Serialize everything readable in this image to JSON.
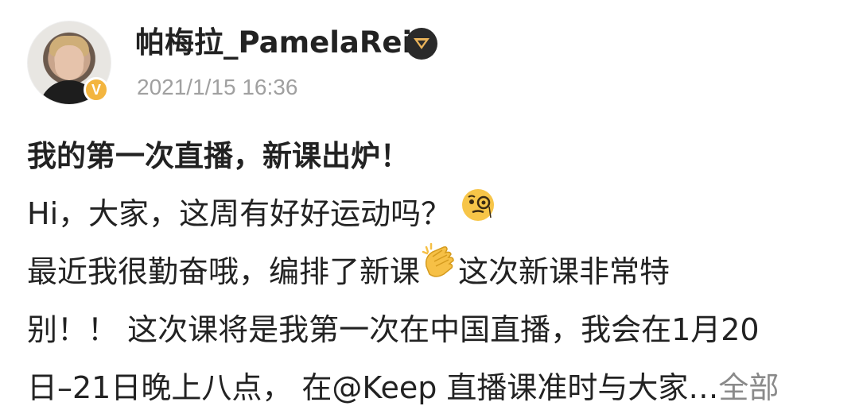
{
  "post": {
    "username": "帕梅拉_PamelaReif",
    "timestamp": "2021/1/15 16:36",
    "title": "我的第一次直播，新课出炉！",
    "line1_text": "Hi，大家，这周有好好运动吗？",
    "line1_emoji": "thinking-monocle-icon",
    "line2_part1": "最近我很勤奋哦，编排了新课",
    "line2_emoji": "clapping-hands-icon",
    "line2_part2": "这次新课非常特",
    "line3": "别！！ 这次课将是我第一次在中国直播，我会在1月20",
    "line4": "日–21日晚上八点， 在@Keep 直播课准时与大家…",
    "more_label": "全部"
  },
  "colors": {
    "verify_badge": "#f3b53f",
    "timestamp": "#a0a0a0",
    "text": "#222222",
    "more_link": "#8a8a8a"
  }
}
